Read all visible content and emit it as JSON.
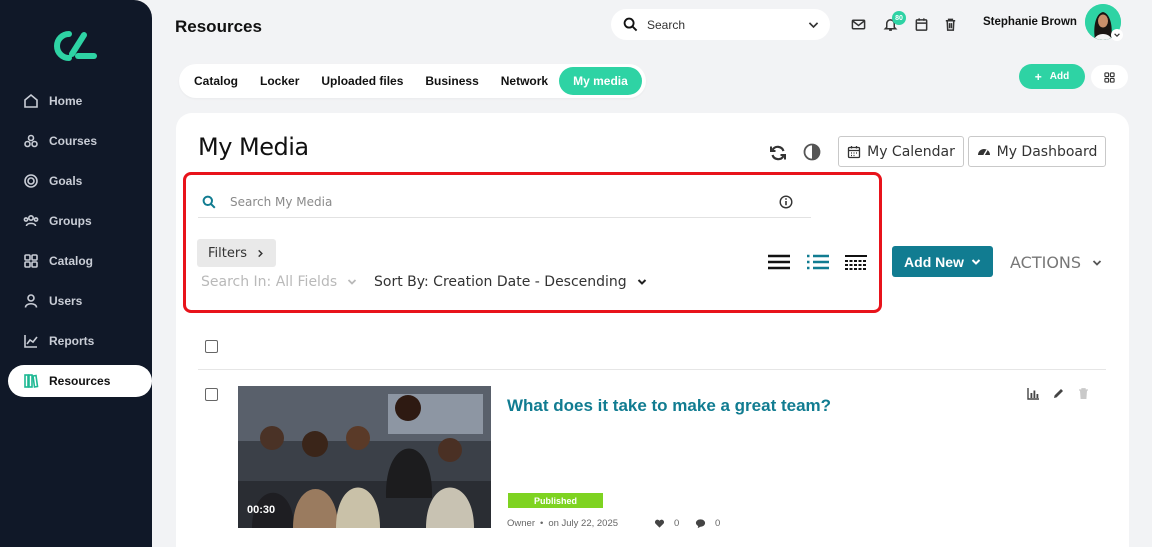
{
  "sidebar": {
    "items": [
      {
        "label": "Home",
        "icon": "home-icon"
      },
      {
        "label": "Courses",
        "icon": "courses-icon"
      },
      {
        "label": "Goals",
        "icon": "goals-icon"
      },
      {
        "label": "Groups",
        "icon": "groups-icon"
      },
      {
        "label": "Catalog",
        "icon": "catalog-icon"
      },
      {
        "label": "Users",
        "icon": "users-icon"
      },
      {
        "label": "Reports",
        "icon": "reports-icon"
      },
      {
        "label": "Resources",
        "icon": "resources-icon",
        "active": true
      }
    ]
  },
  "header": {
    "title": "Resources",
    "search_placeholder": "Search",
    "notification_count": "80",
    "user_name": "Stephanie Brown"
  },
  "tabs": [
    {
      "label": "Catalog"
    },
    {
      "label": "Locker"
    },
    {
      "label": "Uploaded files"
    },
    {
      "label": "Business"
    },
    {
      "label": "Network"
    },
    {
      "label": "My media",
      "active": true
    }
  ],
  "toolbar": {
    "add_label": "Add"
  },
  "media": {
    "title": "My Media",
    "calendar_label": "My Calendar",
    "dashboard_label": "My Dashboard",
    "search_placeholder": "Search My Media",
    "filters_label": "Filters",
    "search_in_label": "Search In: All Fields",
    "sort_by_label": "Sort By: Creation Date - Descending",
    "add_new_label": "Add New",
    "actions_label": "ACTIONS"
  },
  "items": [
    {
      "title": "What does it take to make a great team?",
      "duration": "00:30",
      "status": "Published",
      "owner": "Owner",
      "date": "on July 22, 2025",
      "likes": "0",
      "comments": "0"
    }
  ],
  "colors": {
    "accent": "#2ed3a4",
    "sidebar_bg": "#101828",
    "primary_button": "#117c91",
    "title_link": "#117c91",
    "highlight_border": "#e8131b",
    "published": "#7ed321"
  }
}
